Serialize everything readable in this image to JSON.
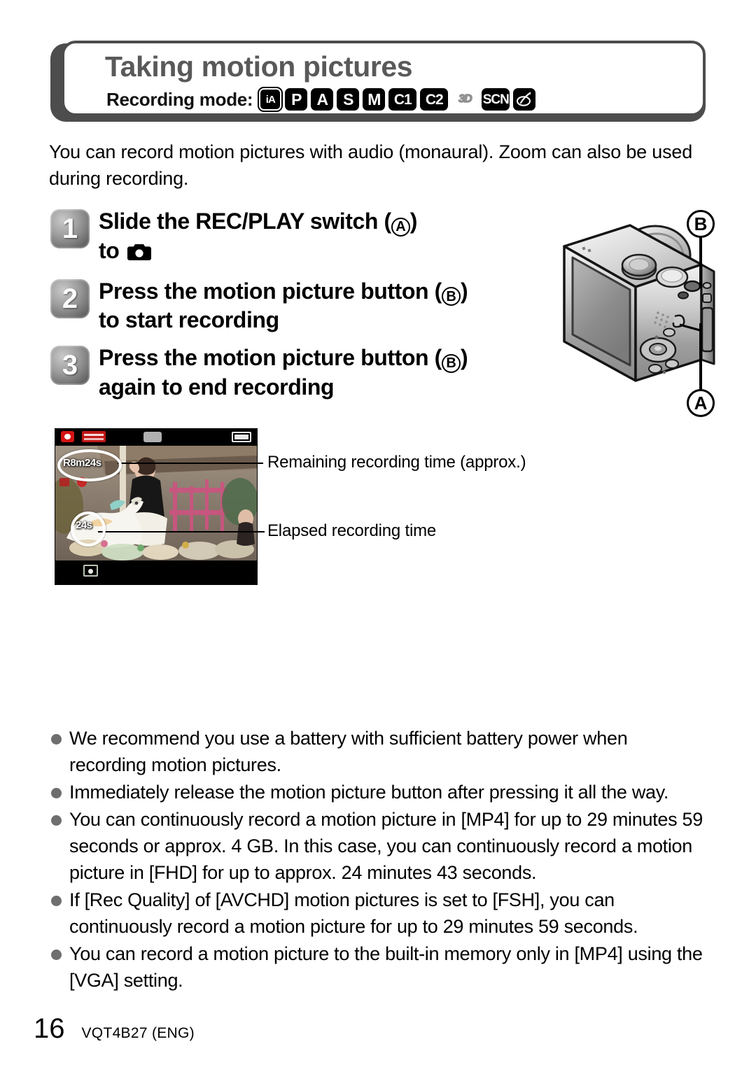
{
  "header": {
    "title": "Taking motion pictures",
    "recording_mode_label": "Recording mode:",
    "modes": [
      {
        "name": "mode-ia",
        "label": "iA"
      },
      {
        "name": "mode-p",
        "label": "P"
      },
      {
        "name": "mode-a",
        "label": "A"
      },
      {
        "name": "mode-s",
        "label": "S"
      },
      {
        "name": "mode-m",
        "label": "M"
      },
      {
        "name": "mode-c1",
        "label": "C1"
      },
      {
        "name": "mode-c2",
        "label": "C2"
      },
      {
        "name": "mode-3d",
        "label": "3D"
      },
      {
        "name": "mode-scn",
        "label": "SCN"
      },
      {
        "name": "mode-creative",
        "label": ""
      }
    ]
  },
  "intro": "You can record motion pictures with audio (monaural). Zoom can also be used during recording.",
  "steps": [
    {
      "number": "1",
      "text_before": "Slide the REC/PLAY switch (",
      "letter": "A",
      "text_after": ")",
      "second_line_before": "to ",
      "second_line_after": "",
      "has_camera_glyph": true
    },
    {
      "number": "2",
      "text_before": "Press the motion picture button (",
      "letter": "B",
      "text_after": ")",
      "second_line_before": "to start recording",
      "second_line_after": "",
      "has_camera_glyph": false
    },
    {
      "number": "3",
      "text_before": "Press the motion picture button (",
      "letter": "B",
      "text_after": ")",
      "second_line_before": "again to end recording",
      "second_line_after": "",
      "has_camera_glyph": false
    }
  ],
  "camera_illustration": {
    "callout_b": "B",
    "callout_a": "A"
  },
  "lcd": {
    "remaining_time": "R8m24s",
    "elapsed_time": "24s"
  },
  "annotations": {
    "remaining": "Remaining recording time (approx.)",
    "elapsed": "Elapsed recording time"
  },
  "notes": [
    "We recommend you use a battery with sufficient battery power when recording motion pictures.",
    "Immediately release the motion picture button after pressing it all the way.",
    "You can continuously record a motion picture in [MP4] for up to 29 minutes 59 seconds or approx. 4 GB. In this case, you can continuously record a motion picture in [FHD] for up to approx. 24 minutes 43 seconds.",
    "If [Rec Quality] of [AVCHD] motion pictures is set to [FSH], you can continuously record a motion picture for up to 29 minutes 59 seconds.",
    "You can record a motion picture to the built-in memory only in [MP4] using the [VGA] setting."
  ],
  "footer": {
    "page_number": "16",
    "doc_code": "VQT4B27 (ENG)"
  },
  "colors": {
    "header_frame": "#4d4d4d",
    "title_gray": "#595959",
    "bullet_gray": "#6e6e6e",
    "rec_red": "#d41414"
  }
}
